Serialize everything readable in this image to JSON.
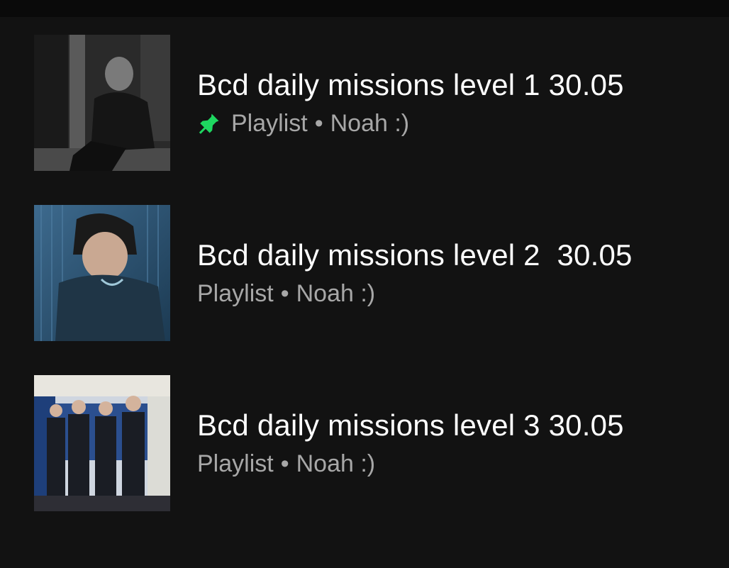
{
  "colors": {
    "background": "#121212",
    "title": "#ffffff",
    "subtitle": "#a7a7a7",
    "pin_accent": "#1ed760"
  },
  "playlists": [
    {
      "title": "Bcd daily missions level 1 30.05",
      "type": "Playlist",
      "separator": "•",
      "owner": "Noah :)",
      "pinned": true,
      "cover_icon": "pin-icon"
    },
    {
      "title": "Bcd daily missions level 2  30.05",
      "type": "Playlist",
      "separator": "•",
      "owner": "Noah :)",
      "pinned": false
    },
    {
      "title": "Bcd daily missions level 3 30.05",
      "type": "Playlist",
      "separator": "•",
      "owner": "Noah :)",
      "pinned": false
    }
  ]
}
